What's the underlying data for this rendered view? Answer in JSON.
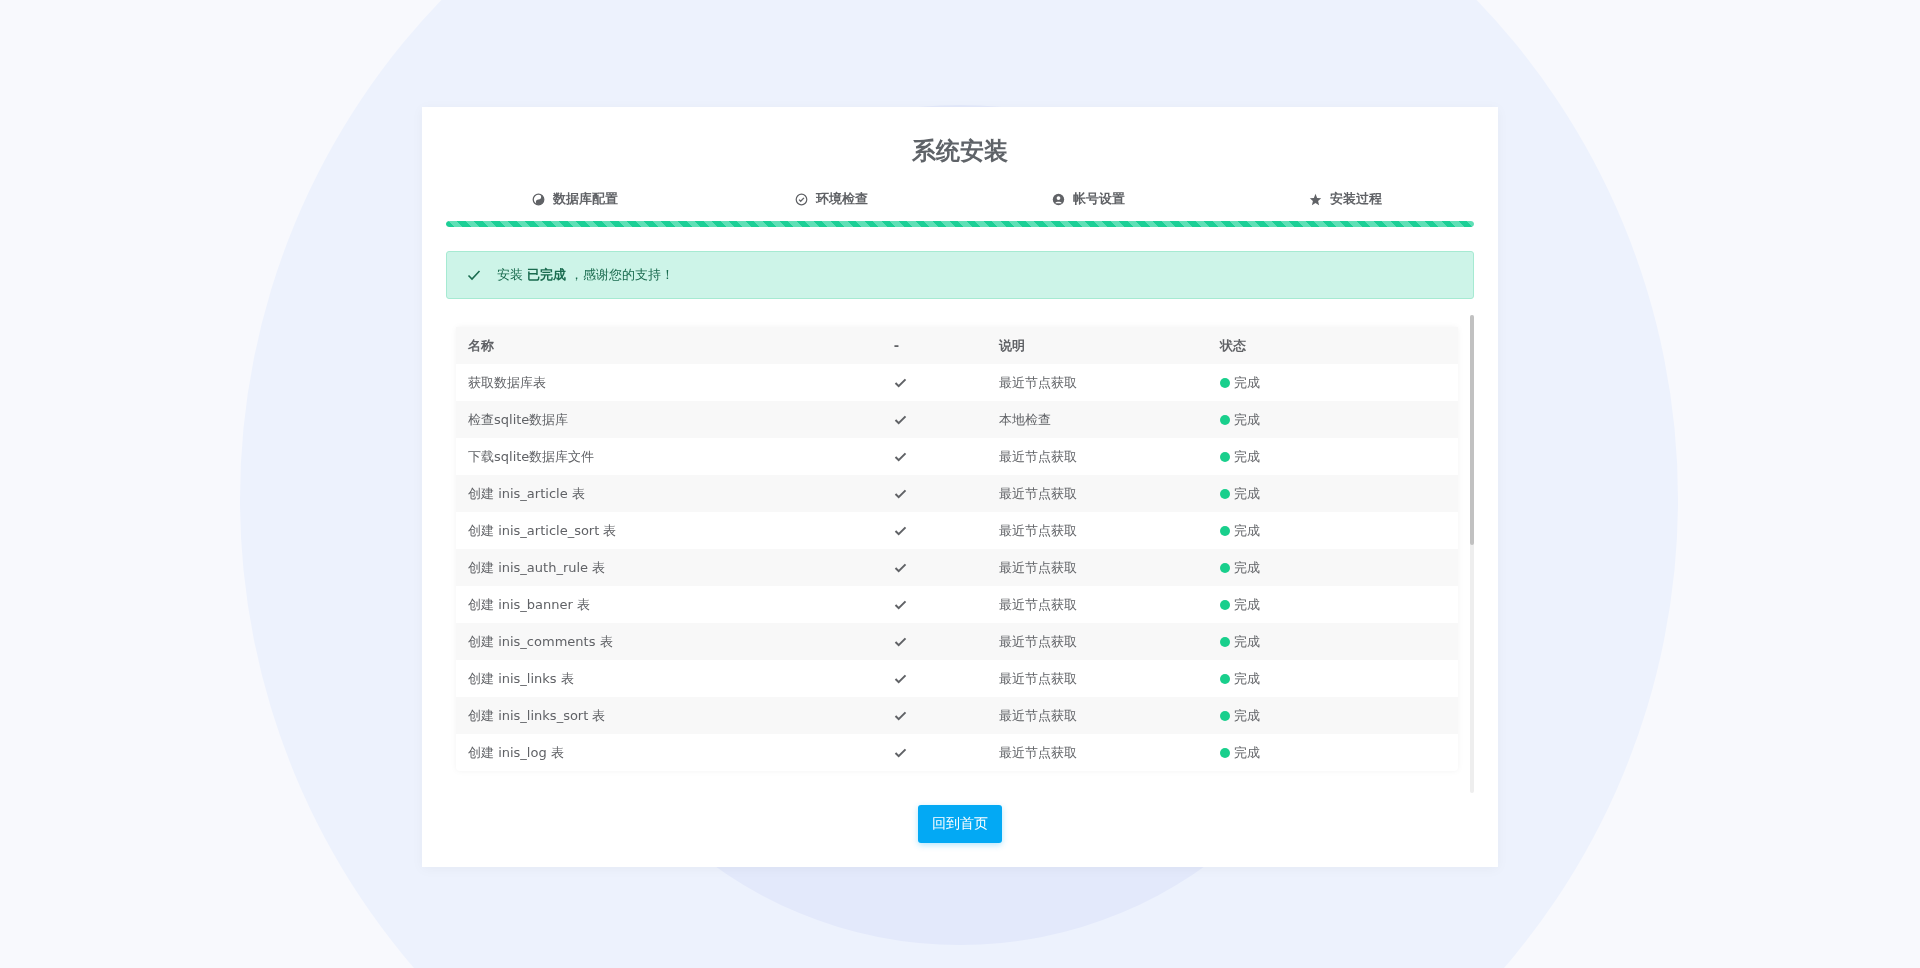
{
  "title": "系统安装",
  "steps": [
    {
      "label": "数据库配置",
      "kind": "database"
    },
    {
      "label": "环境检查",
      "kind": "check"
    },
    {
      "label": "帐号设置",
      "kind": "user"
    },
    {
      "label": "安装过程",
      "kind": "star"
    }
  ],
  "progress": {
    "level": 1
  },
  "alert": {
    "text": "安装 **已完成** ，感谢您的支持！"
  },
  "table": {
    "columns": [
      "名称",
      "-",
      "说明",
      "状态"
    ],
    "rows": [
      {
        "name": "获取数据库表",
        "checked": true,
        "description": "最近节点获取",
        "status": "完成",
        "color": "#19cf8c"
      },
      {
        "name": "检查sqlite数据库",
        "checked": true,
        "description": "本地检查",
        "status": "完成",
        "color": "#19cf8c"
      },
      {
        "name": "下载sqlite数据库文件",
        "checked": true,
        "description": "最近节点获取",
        "status": "完成",
        "color": "#19cf8c"
      },
      {
        "name": "创建 inis_article 表",
        "checked": true,
        "description": "最近节点获取",
        "status": "完成",
        "color": "#19cf8c"
      },
      {
        "name": "创建 inis_article_sort 表",
        "checked": true,
        "description": "最近节点获取",
        "status": "完成",
        "color": "#19cf8c"
      },
      {
        "name": "创建 inis_auth_rule 表",
        "checked": true,
        "description": "最近节点获取",
        "status": "完成",
        "color": "#19cf8c"
      },
      {
        "name": "创建 inis_banner 表",
        "checked": true,
        "description": "最近节点获取",
        "status": "完成",
        "color": "#19cf8c"
      },
      {
        "name": "创建 inis_comments 表",
        "checked": true,
        "description": "最近节点获取",
        "status": "完成",
        "color": "#19cf8c"
      },
      {
        "name": "创建 inis_links 表",
        "checked": true,
        "description": "最近节点获取",
        "status": "完成",
        "color": "#19cf8c"
      },
      {
        "name": "创建 inis_links_sort 表",
        "checked": true,
        "description": "最近节点获取",
        "status": "完成",
        "color": "#19cf8c"
      },
      {
        "name": "创建 inis_log 表",
        "checked": true,
        "description": "最近节点获取",
        "status": "完成",
        "color": "#19cf8c"
      }
    ]
  },
  "button": "回到首页"
}
